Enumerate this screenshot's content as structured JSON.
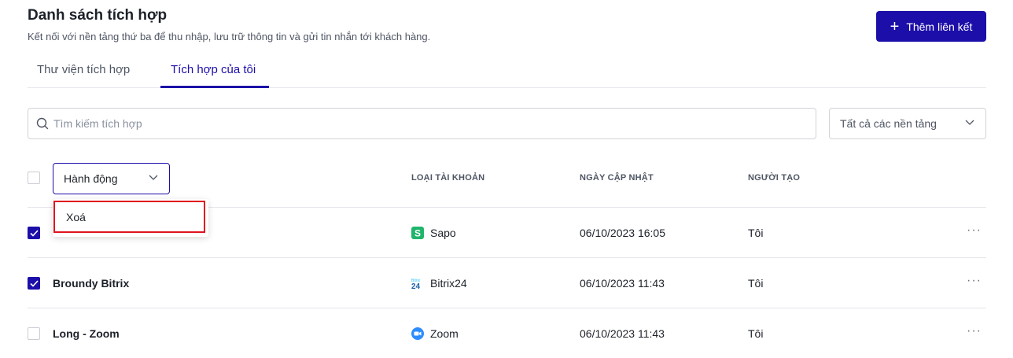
{
  "header": {
    "title": "Danh sách tích hợp",
    "subtitle": "Kết nối với nền tảng thứ ba để thu nhập, lưu trữ thông tin và gửi tin nhắn tới khách hàng.",
    "add_button_label": "Thêm liên kết"
  },
  "tabs": [
    {
      "label": "Thư viện tích hợp",
      "active": false
    },
    {
      "label": "Tích hợp của tôi",
      "active": true
    }
  ],
  "search": {
    "placeholder": "Tìm kiếm tích hợp",
    "value": ""
  },
  "platform_filter": {
    "selected": "Tất cả các nền tảng"
  },
  "table": {
    "action_select_label": "Hành động",
    "columns": [
      "LOẠI TÀI KHOẢN",
      "NGÀY CẬP NHẬT",
      "NGƯỜI TẠO"
    ],
    "rows": [
      {
        "name": "",
        "platform": "Sapo",
        "platform_icon": "sapo-icon",
        "updated": "06/10/2023 16:05",
        "creator": "Tôi",
        "checked": true
      },
      {
        "name": "Broundy Bitrix",
        "platform": "Bitrix24",
        "platform_icon": "bitrix24-icon",
        "updated": "06/10/2023 11:43",
        "creator": "Tôi",
        "checked": true
      },
      {
        "name": "Long - Zoom",
        "platform": "Zoom",
        "platform_icon": "zoom-icon",
        "updated": "06/10/2023 11:43",
        "creator": "Tôi",
        "checked": false
      }
    ]
  },
  "action_menu": {
    "items": [
      "Xoá"
    ]
  },
  "colors": {
    "accent": "#1c0ea8",
    "highlight": "#e0131e",
    "sapo": "#1fb56b",
    "zoom": "#2d8cff",
    "bitrix": "#2fc6f6"
  }
}
